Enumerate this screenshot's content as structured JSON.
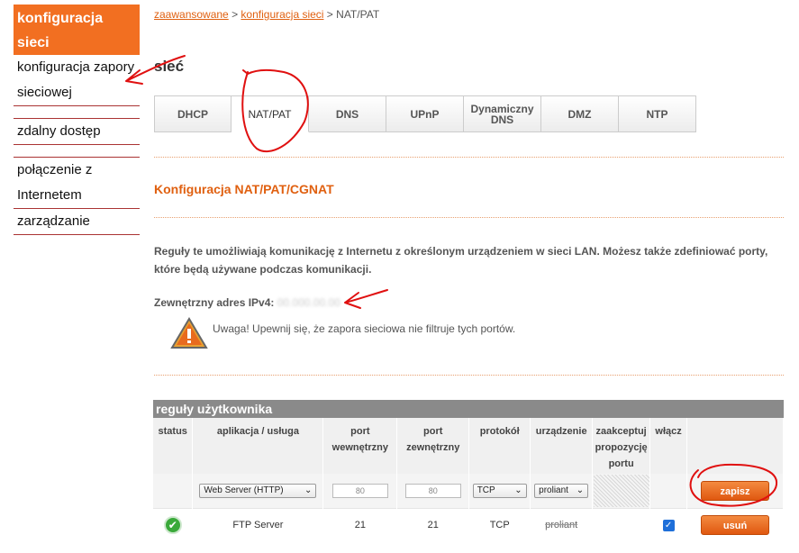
{
  "sidebar": {
    "header": "konfiguracja sieci",
    "items": [
      {
        "label": "konfiguracja zapory sieciowej"
      },
      {
        "label": "zdalny dostęp"
      },
      {
        "label": "połączenie z Internetem"
      },
      {
        "label": "zarządzanie"
      }
    ]
  },
  "breadcrumb": {
    "part1": "zaawansowane",
    "sep1": " > ",
    "part2": "konfiguracja sieci",
    "sep2": " > ",
    "part3": "NAT/PAT"
  },
  "page": {
    "title": "sieć"
  },
  "tabs": [
    {
      "label": "DHCP"
    },
    {
      "label": "NAT/PAT"
    },
    {
      "label": "DNS"
    },
    {
      "label": "UPnP"
    },
    {
      "label": "Dynamiczny DNS"
    },
    {
      "label": "DMZ"
    },
    {
      "label": "NTP"
    }
  ],
  "section": {
    "title": "Konfiguracja NAT/PAT/CGNAT",
    "description": "Reguły te umożliwiają komunikację z Internetu z określonym urządzeniem w sieci LAN. Możesz także zdefiniować porty, które będą używane podczas komunikacji.",
    "external_ip_label": "Zewnętrzny adres IPv4:",
    "external_ip_value": "00.000.00.00",
    "warning": "Uwaga! Upewnij się, że zapora sieciowa nie filtruje tych portów."
  },
  "rules": {
    "title": "reguły użytkownika",
    "columns": [
      "status",
      "aplikacja / usługa",
      "port wewnętrzny",
      "port zewnętrzny",
      "protokół",
      "urządzenie",
      "zaakceptuj propozycję portu",
      "włącz",
      ""
    ],
    "edit_row": {
      "application": "Web Server (HTTP)",
      "internal_port_placeholder": "80",
      "external_port_placeholder": "80",
      "protocol": "TCP",
      "device": "proliant",
      "save_label": "zapisz"
    },
    "rows": [
      {
        "application": "FTP Server",
        "internal_port": "21",
        "external_port": "21",
        "protocol": "TCP",
        "device": "proliant",
        "enabled": true,
        "delete_label": "usuń"
      }
    ]
  },
  "colors": {
    "accent": "#f26f21",
    "link": "#e06010",
    "annotation": "#e01010"
  }
}
